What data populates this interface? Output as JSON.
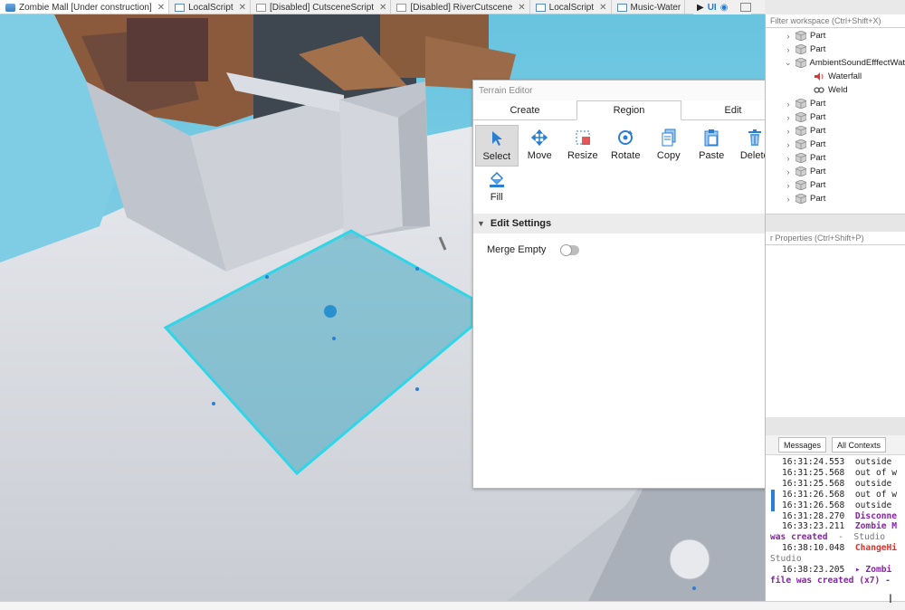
{
  "tabs": [
    {
      "label": "Zombie Mall [Under construction]",
      "kind": "place",
      "active": true
    },
    {
      "label": "LocalScript",
      "kind": "script",
      "active": false
    },
    {
      "label": "[Disabled] CutsceneScript",
      "kind": "script-disabled",
      "active": false
    },
    {
      "label": "[Disabled] RiverCutscene",
      "kind": "script-disabled",
      "active": false
    },
    {
      "label": "LocalScript",
      "kind": "script",
      "active": false
    },
    {
      "label": "Music-Water",
      "kind": "script",
      "active": false
    }
  ],
  "tab_nav": {
    "ui_label": "UI"
  },
  "terrain_editor": {
    "title": "Terrain Editor",
    "tabs": [
      "Create",
      "Region",
      "Edit"
    ],
    "active_tab": "Region",
    "tools": [
      {
        "label": "Select",
        "icon": "cursor-icon",
        "selected": true
      },
      {
        "label": "Move",
        "icon": "move-icon",
        "selected": false
      },
      {
        "label": "Resize",
        "icon": "resize-icon",
        "selected": false
      },
      {
        "label": "Rotate",
        "icon": "rotate-icon",
        "selected": false
      },
      {
        "label": "Copy",
        "icon": "copy-icon",
        "selected": false
      },
      {
        "label": "Paste",
        "icon": "paste-icon",
        "selected": false
      },
      {
        "label": "Delete",
        "icon": "trash-icon",
        "selected": false
      },
      {
        "label": "Fill",
        "icon": "fill-bucket-icon",
        "selected": false
      }
    ],
    "section_title": "Edit Settings",
    "settings": [
      {
        "label": "Merge Empty",
        "value": false
      }
    ]
  },
  "explorer": {
    "filter_placeholder": "Filter workspace (Ctrl+Shift+X)",
    "rows": [
      {
        "label": "Part",
        "indent": 1,
        "chevron": "right",
        "icon": "part-icon"
      },
      {
        "label": "Part",
        "indent": 1,
        "chevron": "right",
        "icon": "part-icon"
      },
      {
        "label": "AmbientSoundEfffectWat",
        "indent": 1,
        "chevron": "down",
        "icon": "part-icon"
      },
      {
        "label": "Waterfall",
        "indent": 2,
        "chevron": "",
        "icon": "sound-icon"
      },
      {
        "label": "Weld",
        "indent": 2,
        "chevron": "",
        "icon": "weld-icon"
      },
      {
        "label": "Part",
        "indent": 1,
        "chevron": "right",
        "icon": "part-icon"
      },
      {
        "label": "Part",
        "indent": 1,
        "chevron": "right",
        "icon": "part-icon"
      },
      {
        "label": "Part",
        "indent": 1,
        "chevron": "right",
        "icon": "part-icon"
      },
      {
        "label": "Part",
        "indent": 1,
        "chevron": "right",
        "icon": "part-icon"
      },
      {
        "label": "Part",
        "indent": 1,
        "chevron": "right",
        "icon": "part-icon"
      },
      {
        "label": "Part",
        "indent": 1,
        "chevron": "right",
        "icon": "part-icon"
      },
      {
        "label": "Part",
        "indent": 1,
        "chevron": "right",
        "icon": "part-icon"
      },
      {
        "label": "Part",
        "indent": 1,
        "chevron": "right",
        "icon": "part-icon"
      }
    ]
  },
  "properties": {
    "filter_placeholder": "r Properties (Ctrl+Shift+P)"
  },
  "output": {
    "messages_dropdown": "Messages",
    "contexts_dropdown": "All Contexts",
    "lines": [
      {
        "text": "16:31:24.553  outside",
        "style": "normal",
        "bar": false
      },
      {
        "text": "16:31:25.568  out of w",
        "style": "normal",
        "bar": false
      },
      {
        "text": "16:31:25.568  outside",
        "style": "normal",
        "bar": false
      },
      {
        "text": "16:31:26.568  out of w",
        "style": "normal",
        "bar": true
      },
      {
        "text": "16:31:26.568  outside",
        "style": "normal",
        "bar": true
      },
      {
        "text": "16:31:28.270  Disconne",
        "style": "purple-tail",
        "bar": false
      },
      {
        "text": "16:33:23.211  Zombie M",
        "style": "purple-tail",
        "bar": false
      },
      {
        "text": "was created  -  Studio",
        "style": "purple-head",
        "bar": false
      },
      {
        "text": "16:38:10.048  ChangeHi",
        "style": "red-tail",
        "bar": false
      },
      {
        "text": "Studio",
        "style": "gray",
        "bar": false
      },
      {
        "text": "16:38:23.205  ▸ Zombi",
        "style": "purple-tail",
        "bar": false
      },
      {
        "text": "file was created (x7) -",
        "style": "purple",
        "bar": false
      }
    ]
  }
}
